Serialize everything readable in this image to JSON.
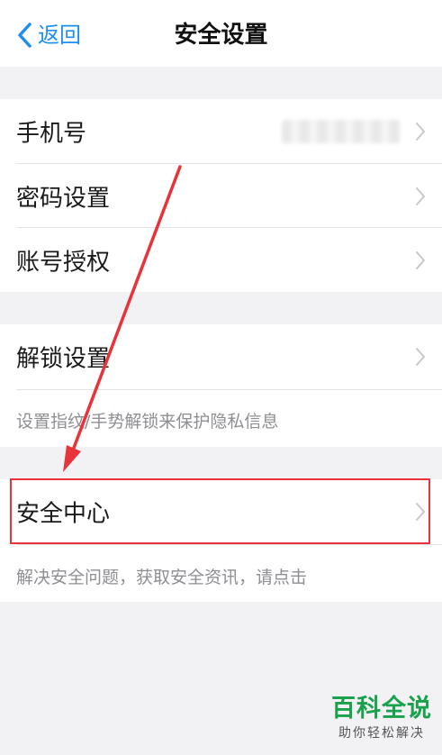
{
  "nav": {
    "back_label": "返回",
    "title": "安全设置"
  },
  "account_group": {
    "items": [
      {
        "label": "手机号",
        "value": "(masked)"
      },
      {
        "label": "密码设置"
      },
      {
        "label": "账号授权"
      }
    ]
  },
  "unlock_group": {
    "label": "解锁设置",
    "hint": "设置指纹/手势解锁来保护隐私信息"
  },
  "security_group": {
    "label": "安全中心",
    "hint": "解决安全问题，获取安全资讯，请点击"
  },
  "annotation": {
    "highlight_color": "#e8333a"
  },
  "watermark": {
    "main": "百科全说",
    "sub": "助你轻松解决"
  },
  "colors": {
    "accent": "#1e8ff0",
    "background": "#f2f2f5",
    "watermark_green": "#1aa14c"
  },
  "icons": {
    "back": "chevron-left-icon",
    "row_chevron": "chevron-right-icon"
  }
}
